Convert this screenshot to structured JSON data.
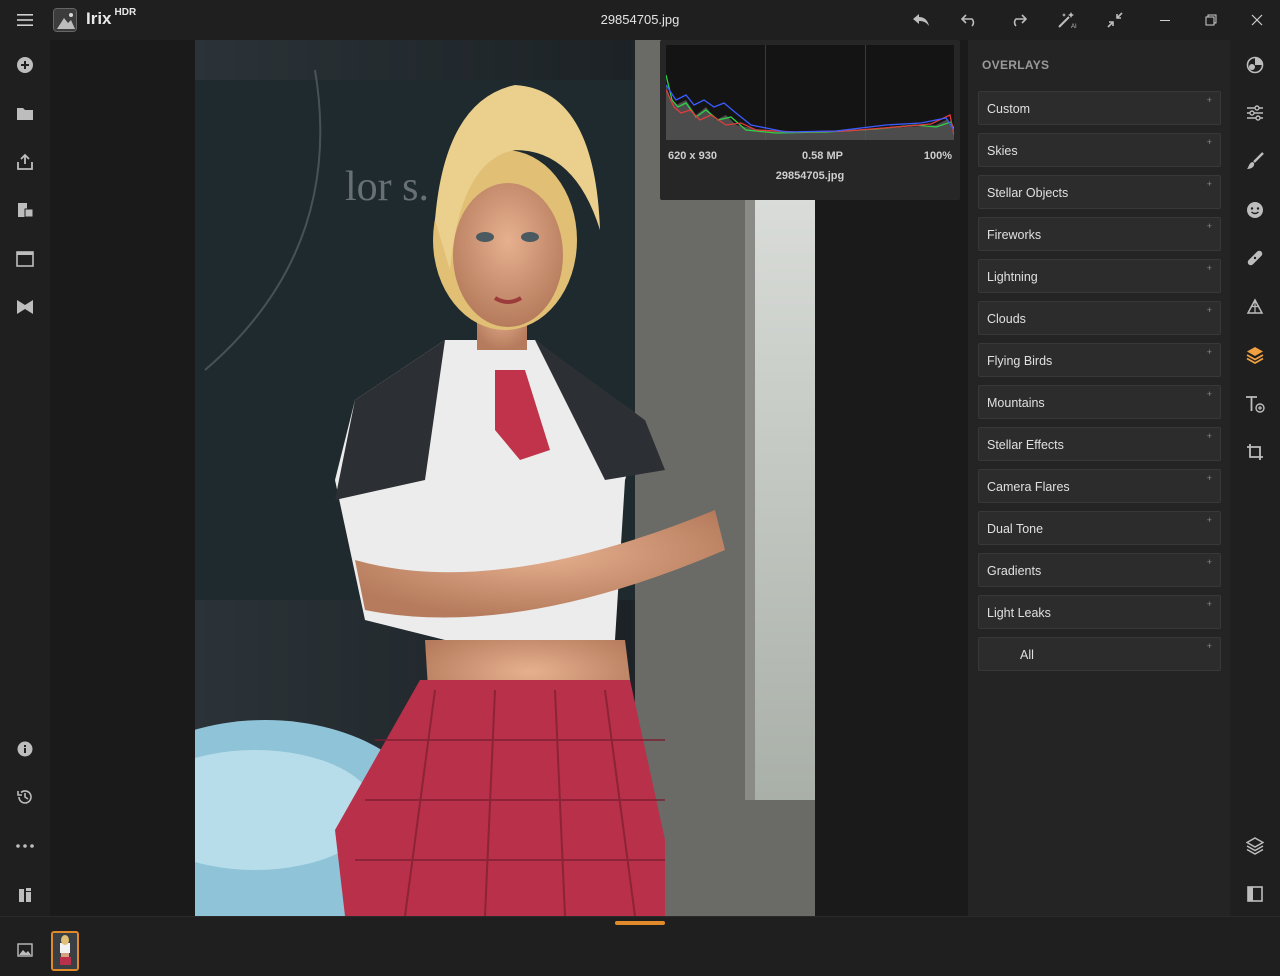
{
  "app": {
    "name": "Irix",
    "name_suffix": "HDR",
    "file_title": "29854705.jpg"
  },
  "histogram": {
    "dimensions": "620 x 930",
    "megapixels": "0.58 MP",
    "zoom": "100%",
    "filename": "29854705.jpg"
  },
  "overlays": {
    "title": "OVERLAYS",
    "items": [
      {
        "label": "Custom",
        "plus": "+"
      },
      {
        "label": "Skies",
        "plus": "+"
      },
      {
        "label": "Stellar Objects",
        "plus": "+"
      },
      {
        "label": "Fireworks",
        "plus": "+"
      },
      {
        "label": "Lightning",
        "plus": "+"
      },
      {
        "label": "Clouds",
        "plus": "+"
      },
      {
        "label": "Flying Birds",
        "plus": "+"
      },
      {
        "label": "Mountains",
        "plus": "+"
      },
      {
        "label": "Stellar Effects",
        "plus": "+"
      },
      {
        "label": "Camera Flares",
        "plus": "+"
      },
      {
        "label": "Dual Tone",
        "plus": "+"
      },
      {
        "label": "Gradients",
        "plus": "+"
      },
      {
        "label": "Light Leaks",
        "plus": "+"
      },
      {
        "label": "All",
        "plus": "+"
      }
    ]
  },
  "icons": {
    "left": [
      "add-icon",
      "folder-icon",
      "export-icon",
      "batch-icon",
      "window-icon",
      "flag-icon",
      "info-icon",
      "history-icon",
      "more-icon",
      "compare-icon"
    ],
    "right": [
      "presets-icon",
      "adjust-sliders-icon",
      "brush-icon",
      "face-icon",
      "heal-icon",
      "transform-icon",
      "overlays-layers-icon",
      "text-icon",
      "crop-icon",
      "layers-stack-icon",
      "split-view-icon"
    ]
  },
  "colors": {
    "accent": "#e08a2c",
    "active_icon": "#f0a040"
  }
}
